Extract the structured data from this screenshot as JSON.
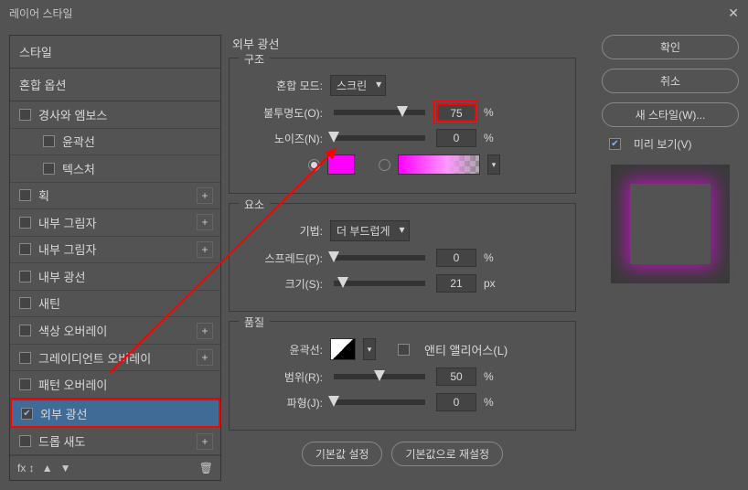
{
  "window": {
    "title": "레이어 스타일"
  },
  "sidebar": {
    "styles_header": "스타일",
    "blend_header": "혼합 옵션",
    "items": [
      {
        "label": "경사와 엠보스",
        "checked": false,
        "plus": false,
        "sub": false
      },
      {
        "label": "윤곽선",
        "checked": false,
        "plus": false,
        "sub": true
      },
      {
        "label": "텍스처",
        "checked": false,
        "plus": false,
        "sub": true
      },
      {
        "label": "획",
        "checked": false,
        "plus": true,
        "sub": false
      },
      {
        "label": "내부 그림자",
        "checked": false,
        "plus": true,
        "sub": false
      },
      {
        "label": "내부 그림자",
        "checked": false,
        "plus": true,
        "sub": false
      },
      {
        "label": "내부 광선",
        "checked": false,
        "plus": false,
        "sub": false
      },
      {
        "label": "새틴",
        "checked": false,
        "plus": false,
        "sub": false
      },
      {
        "label": "색상 오버레이",
        "checked": false,
        "plus": true,
        "sub": false
      },
      {
        "label": "그레이디언트 오버레이",
        "checked": false,
        "plus": true,
        "sub": false
      },
      {
        "label": "패턴 오버레이",
        "checked": false,
        "plus": false,
        "sub": false
      },
      {
        "label": "외부 광선",
        "checked": true,
        "plus": false,
        "sub": false,
        "selected": true
      },
      {
        "label": "드롭 새도",
        "checked": false,
        "plus": true,
        "sub": false
      }
    ],
    "fx_label": "fx"
  },
  "content": {
    "title": "외부 광선",
    "structure": {
      "title": "구조",
      "blend_mode_label": "혼합 모드:",
      "blend_mode_value": "스크린",
      "opacity_label": "불투명도(O):",
      "opacity_value": "75",
      "opacity_unit": "%",
      "noise_label": "노이즈(N):",
      "noise_value": "0",
      "noise_unit": "%",
      "color_hex": "#ff00ff"
    },
    "element": {
      "title": "요소",
      "technique_label": "기법:",
      "technique_value": "더 부드럽게",
      "spread_label": "스프레드(P):",
      "spread_value": "0",
      "spread_unit": "%",
      "size_label": "크기(S):",
      "size_value": "21",
      "size_unit": "px"
    },
    "quality": {
      "title": "품질",
      "contour_label": "윤곽선:",
      "anti_alias_label": "앤티 앨리어스(L)",
      "range_label": "범위(R):",
      "range_value": "50",
      "range_unit": "%",
      "jitter_label": "파형(J):",
      "jitter_value": "0",
      "jitter_unit": "%"
    },
    "defaults_set": "기본값 설정",
    "defaults_reset": "기본값으로 재설정"
  },
  "right": {
    "ok": "확인",
    "cancel": "취소",
    "new_style": "새 스타일(W)...",
    "preview": "미리 보기(V)"
  }
}
